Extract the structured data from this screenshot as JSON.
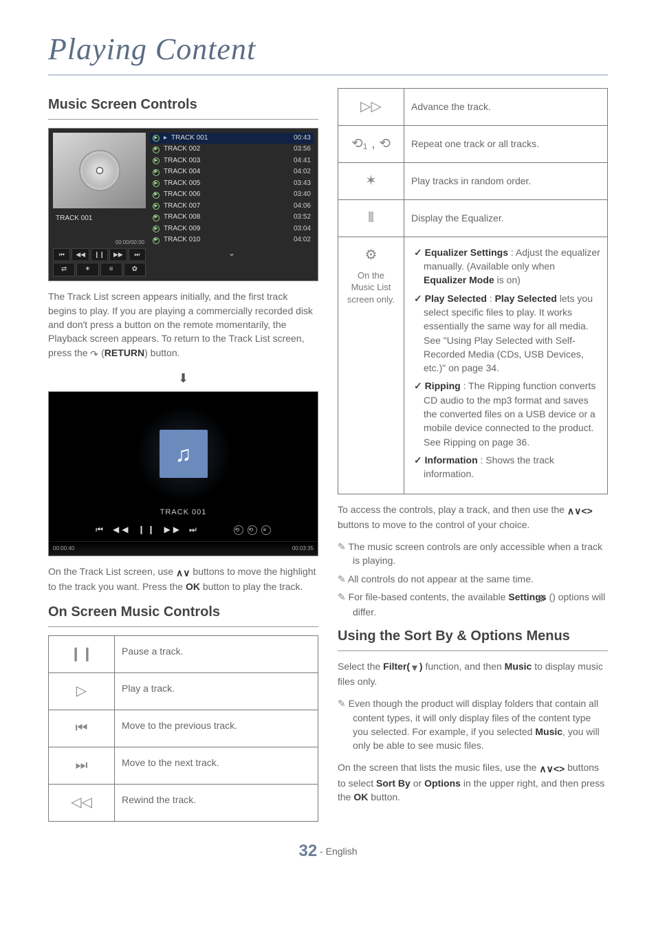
{
  "page_title": "Playing Content",
  "sections": {
    "music_screen_controls": "Music Screen Controls",
    "on_screen_music_controls": "On Screen Music Controls",
    "using_sort_options": "Using the Sort By & Options Menus"
  },
  "tracklist": {
    "selected_label": "TRACK 001",
    "time_readout": "00:00/00:00",
    "items": [
      {
        "name": "TRACK 001",
        "time": "00:43"
      },
      {
        "name": "TRACK 002",
        "time": "03:56"
      },
      {
        "name": "TRACK 003",
        "time": "04:41"
      },
      {
        "name": "TRACK 004",
        "time": "04:02"
      },
      {
        "name": "TRACK 005",
        "time": "03:43"
      },
      {
        "name": "TRACK 006",
        "time": "03:40"
      },
      {
        "name": "TRACK 007",
        "time": "04:06"
      },
      {
        "name": "TRACK 008",
        "time": "03:52"
      },
      {
        "name": "TRACK 009",
        "time": "03:04"
      },
      {
        "name": "TRACK 010",
        "time": "04:02"
      }
    ],
    "mini_controls_row1": [
      "⏮",
      "◀◀",
      "❙❙",
      "▶▶",
      "⏭"
    ],
    "mini_controls_row2": [
      "⇄",
      "✶",
      "≡",
      "✿"
    ]
  },
  "paragraphs": {
    "p1_a": "The Track List screen appears initially, and the first track begins to play. If you are playing a commercially recorded disk and don't press a button on the remote momentarily, the Playback screen appears. To return to the Track List screen, press the ",
    "p1_b_glyph": "↶",
    "p1_c": " (",
    "p1_d_bold": "RETURN",
    "p1_e": ") button.",
    "p2_a": "On the Track List screen, use ",
    "p2_b_glyph": "∧∨",
    "p2_c": " buttons to move the highlight to the track you want. Press the ",
    "p2_d_bold": "OK",
    "p2_e": " button to play the track.",
    "access_a": "To access the controls, play a track, and then use the ",
    "access_b_glyph": "∧∨<>",
    "access_c": " buttons to move to the control of your choice.",
    "sort_a": "Select the ",
    "sort_b_bold": "Filter(",
    "sort_c_glyph": "▼",
    "sort_d_bold": ")",
    "sort_e": " function, and then ",
    "sort_f_bold": "Music",
    "sort_g": " to display music files only.",
    "sort2_a": "On the screen that lists the music files, use the ",
    "sort2_b_glyph": "∧∨<>",
    "sort2_c": " buttons to select ",
    "sort2_d_bold": "Sort By",
    "sort2_e": " or ",
    "sort2_f_bold": "Options",
    "sort2_g": " in the upper right, and then press the ",
    "sort2_h_bold": "OK",
    "sort2_i": " button."
  },
  "playback": {
    "track_label": "TRACK 001",
    "controls": [
      "⏮",
      "◀◀",
      "❙❙",
      "▶▶",
      "⏭"
    ],
    "side_icons": [
      "⟲",
      "⟲",
      "≡"
    ],
    "elapsed": "00:00:40",
    "total": "00:03:35"
  },
  "left_controls": [
    {
      "glyph": "❙❙",
      "desc": "Pause a track."
    },
    {
      "glyph": "▷",
      "desc": "Play a track."
    },
    {
      "glyph": "⏮",
      "desc": "Move to the previous track."
    },
    {
      "glyph": "⏭",
      "desc": "Move to the next track."
    },
    {
      "glyph": "◁◁",
      "desc": "Rewind the track."
    }
  ],
  "right_controls": [
    {
      "glyph": "▷▷",
      "desc": "Advance the track."
    },
    {
      "glyph": "⟲₁ , ⟲",
      "desc": "Repeat one track or all tracks."
    },
    {
      "glyph": "✶",
      "desc": "Play tracks in random order."
    },
    {
      "glyph": "⦀",
      "desc": "Display the Equalizer."
    }
  ],
  "settings_cell": {
    "icon": "⚙",
    "caption": "On the Music List screen only.",
    "items": [
      {
        "label": "Equalizer Settings",
        "text": " : Adjust the equalizer manually. (Available only when ",
        "bold2": "Equalizer Mode",
        "text2": " is on)"
      },
      {
        "label": "Play Selected",
        "text": " : ",
        "bold2": "Play Selected",
        "text2": " lets you select specific files to play. It works essentially the same way for all media. See \"Using Play Selected with Self-Recorded Media (CDs, USB Devices, etc.)\" on page 34."
      },
      {
        "label": "Ripping",
        "text": " : The Ripping function converts CD audio to the mp3 format and saves the converted files on a USB device or a mobile device connected to the product. See Ripping on page 36.",
        "bold2": "",
        "text2": ""
      },
      {
        "label": "Information",
        "text": " : Shows the track information.",
        "bold2": "",
        "text2": ""
      }
    ]
  },
  "notes": {
    "n1": "The music screen controls are only accessible when a track is playing.",
    "n2": "All controls do not appear at the same time.",
    "n3_a": "For file-based contents, the available ",
    "n3_b_bold": "Settings",
    "n3_c": " (",
    "n3_d_glyph": "⚙",
    "n3_e": ") options will differ.",
    "n4_a": "Even though the product will display folders that contain all content types, it will only display files of the content type you selected. For example, if you selected ",
    "n4_b_bold": "Music",
    "n4_c": ", you will only be able to see music files."
  },
  "footer": {
    "page_num": "32",
    "lang": " - English"
  }
}
